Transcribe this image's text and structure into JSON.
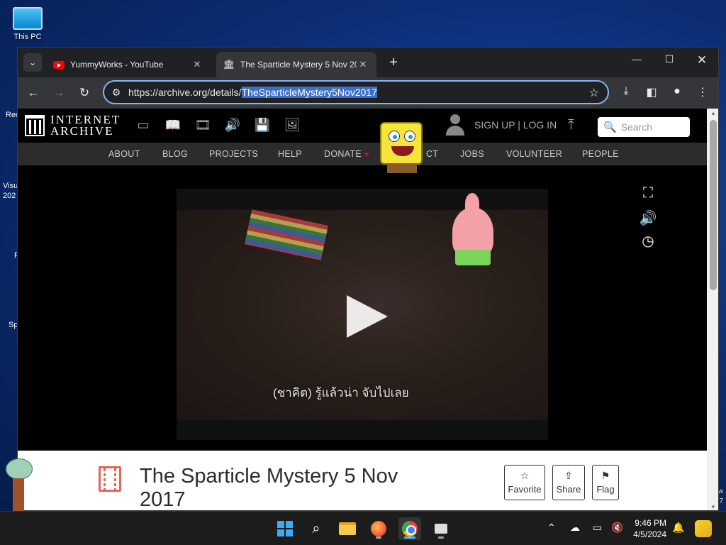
{
  "desktop": {
    "icons": [
      {
        "label": "This PC",
        "icon": "monitor-icon"
      }
    ],
    "left_slivers": [
      "Rec",
      "Visu",
      "202",
      "F",
      "Sp"
    ],
    "right_slivers": [
      "w",
      "7"
    ]
  },
  "browser": {
    "tabs": [
      {
        "label": "YummyWorks - YouTube",
        "icon": "youtube-icon",
        "active": false
      },
      {
        "label": "The Sparticle Mystery 5 Nov 20",
        "icon": "archive-icon",
        "active": true
      }
    ],
    "url": {
      "prefix": "https://",
      "host": "archive.org",
      "path": "/details/",
      "selected": "TheSparticleMystery5Nov2017"
    }
  },
  "archive": {
    "logo_line1": "INTERNET",
    "logo_line2": "ARCHIVE",
    "auth": "SIGN UP | LOG IN",
    "search_placeholder": "Search",
    "nav": [
      "ABOUT",
      "BLOG",
      "PROJECTS",
      "HELP",
      "DONATE",
      "CT",
      "JOBS",
      "VOLUNTEER",
      "PEOPLE"
    ],
    "video": {
      "subtitle": "(ชาคิต) รู้แล้วน่า จับไปเลย"
    },
    "item": {
      "title": "The Sparticle Mystery 5 Nov 2017",
      "actions": [
        {
          "label": "Favorite",
          "icon": "star-icon"
        },
        {
          "label": "Share",
          "icon": "share-icon"
        },
        {
          "label": "Flag",
          "icon": "flag-icon"
        }
      ]
    }
  },
  "taskbar": {
    "time": "9:46 PM",
    "date": "4/5/2024"
  },
  "colors": {
    "accent": "#8ab4f8",
    "selection": "#3b6fc9",
    "donate_heart": "#e0002b"
  }
}
